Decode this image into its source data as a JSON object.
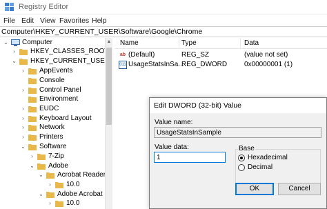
{
  "window": {
    "title": "Registry Editor"
  },
  "menu": [
    "File",
    "Edit",
    "View",
    "Favorites",
    "Help"
  ],
  "address": "Computer\\HKEY_CURRENT_USER\\Software\\Google\\Chrome",
  "tree": {
    "computer": "Computer",
    "classes_root": "HKEY_CLASSES_ROOT",
    "current_user": "HKEY_CURRENT_USER",
    "appevents": "AppEvents",
    "console": "Console",
    "control_panel": "Control Panel",
    "environment": "Environment",
    "eudc": "EUDC",
    "keyboard_layout": "Keyboard Layout",
    "network": "Network",
    "printers": "Printers",
    "software": "Software",
    "zip": "7-Zip",
    "adobe": "Adobe",
    "acrobat_reader": "Acrobat Reader",
    "reader_ver": "10.0",
    "adobe_acrobat": "Adobe Acrobat",
    "acrobat_ver": "10.0"
  },
  "columns": {
    "name": "Name",
    "type": "Type",
    "data": "Data"
  },
  "values": [
    {
      "icon": "ab",
      "name": "(Default)",
      "type": "REG_SZ",
      "data": "(value not set)"
    },
    {
      "icon": "011",
      "name": "UsageStatsInSa...",
      "type": "REG_DWORD",
      "data": "0x00000001 (1)"
    }
  ],
  "dialog": {
    "title": "Edit DWORD (32-bit) Value",
    "value_name_label": "Value name:",
    "value_name": "UsageStatsInSample",
    "value_data_label": "Value data:",
    "value_data": "1",
    "base_label": "Base",
    "hex_label": "Hexadecimal",
    "dec_label": "Decimal",
    "base_selected": "Hexadecimal",
    "ok_label": "OK",
    "cancel_label": "Cancel"
  },
  "colors": {
    "folder": "#e8b84a",
    "accent": "#0078d7"
  }
}
